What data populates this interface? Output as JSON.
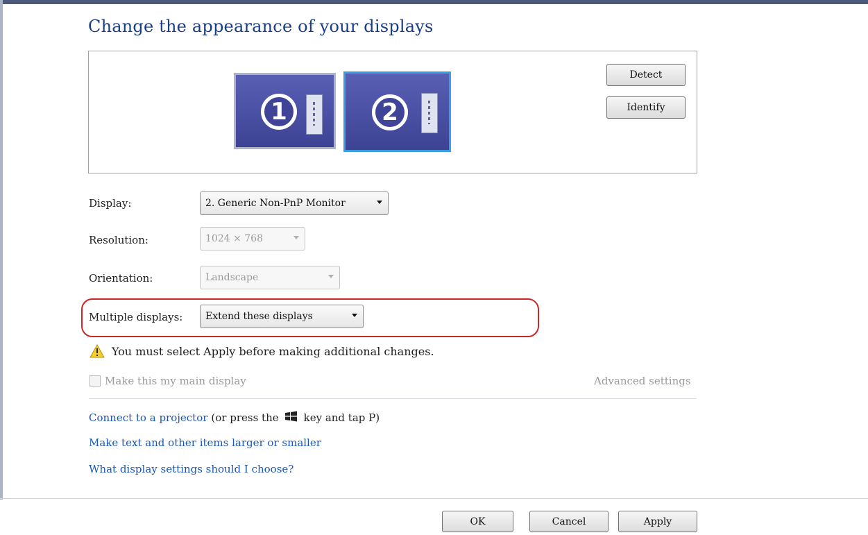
{
  "title": "Change the appearance of your displays",
  "preview": {
    "monitor1_number": "1",
    "monitor2_number": "2",
    "detect_label": "Detect",
    "identify_label": "Identify"
  },
  "settings": {
    "display_label": "Display:",
    "display_value": "2. Generic Non-PnP Monitor",
    "resolution_label": "Resolution:",
    "resolution_value": "1024 × 768",
    "orientation_label": "Orientation:",
    "orientation_value": "Landscape",
    "multiple_label": "Multiple displays:",
    "multiple_value": "Extend these displays"
  },
  "warning": {
    "icon": "warning-icon",
    "text": "You must select Apply before making additional changes."
  },
  "main_display_checkbox": {
    "label": "Make this my main display",
    "checked": false
  },
  "advanced_settings": "Advanced settings",
  "links": {
    "projector_link": "Connect to a projector",
    "projector_hint_before": "(or press the",
    "projector_hint_icon": "windows-logo-icon",
    "projector_hint_after": "key and tap P)",
    "text_size_link": "Make text and other items larger or smaller",
    "help_link": "What display settings should I choose?"
  },
  "footer": {
    "ok_label": "OK",
    "cancel_label": "Cancel",
    "apply_label": "Apply"
  },
  "colors": {
    "title": "#1a3e84",
    "link": "#1c56b4",
    "highlight": "#c8282a",
    "monitor_fill": "#4a50a4",
    "selected_monitor_border": "#3b9ee0"
  }
}
